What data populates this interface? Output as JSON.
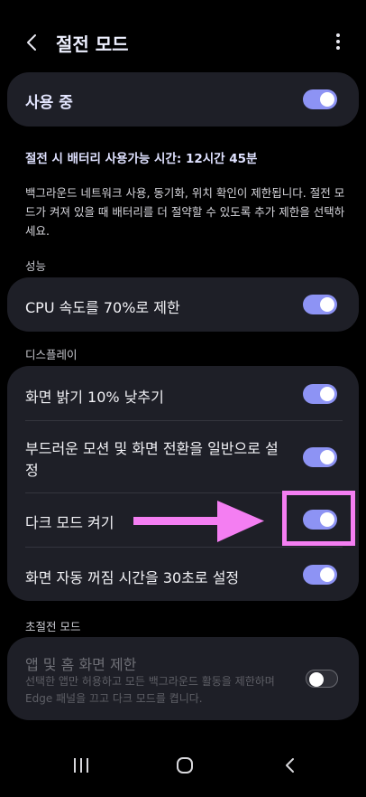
{
  "header": {
    "title": "절전 모드"
  },
  "master": {
    "label": "사용 중",
    "enabled": true
  },
  "battery_time": "절전 시 배터리 사용가능 시간: 12시간 45분",
  "description": "백그라운드 네트워크 사용, 동기화, 위치 확인이 제한됩니다. 절전 모드가 켜져 있을 때 배터리를 더 절약할 수 있도록 추가 제한을 선택하세요.",
  "sections": {
    "performance": {
      "title": "성능",
      "items": [
        {
          "label": "CPU 속도를 70%로 제한",
          "enabled": true
        }
      ]
    },
    "display": {
      "title": "디스플레이",
      "items": [
        {
          "label": "화면 밝기 10% 낮추기",
          "enabled": true
        },
        {
          "label": "부드러운 모션 및 화면 전환을 일반으로 설정",
          "enabled": true
        },
        {
          "label": "다크 모드 켜기",
          "enabled": true
        },
        {
          "label": "화면 자동 꺼짐 시간을 30초로 설정",
          "enabled": true
        }
      ]
    },
    "ultra": {
      "title": "초절전 모드",
      "item": {
        "label": "앱 및 홈 화면 제한",
        "sublabel": "선택한 앱만 허용하고 모든 백그라운드 활동을 제한하며 Edge 패널을 끄고 다크 모드를 켭니다.",
        "enabled": false,
        "disabled": true
      }
    }
  },
  "colors": {
    "accent": "#8d93f4",
    "card": "#1e1f27",
    "annotation": "#f47ef2"
  },
  "icons": {
    "back": "chevron-left-icon",
    "more": "more-vertical-icon",
    "nav_recent": "recent-apps-icon",
    "nav_home": "home-icon",
    "nav_back": "back-icon"
  }
}
